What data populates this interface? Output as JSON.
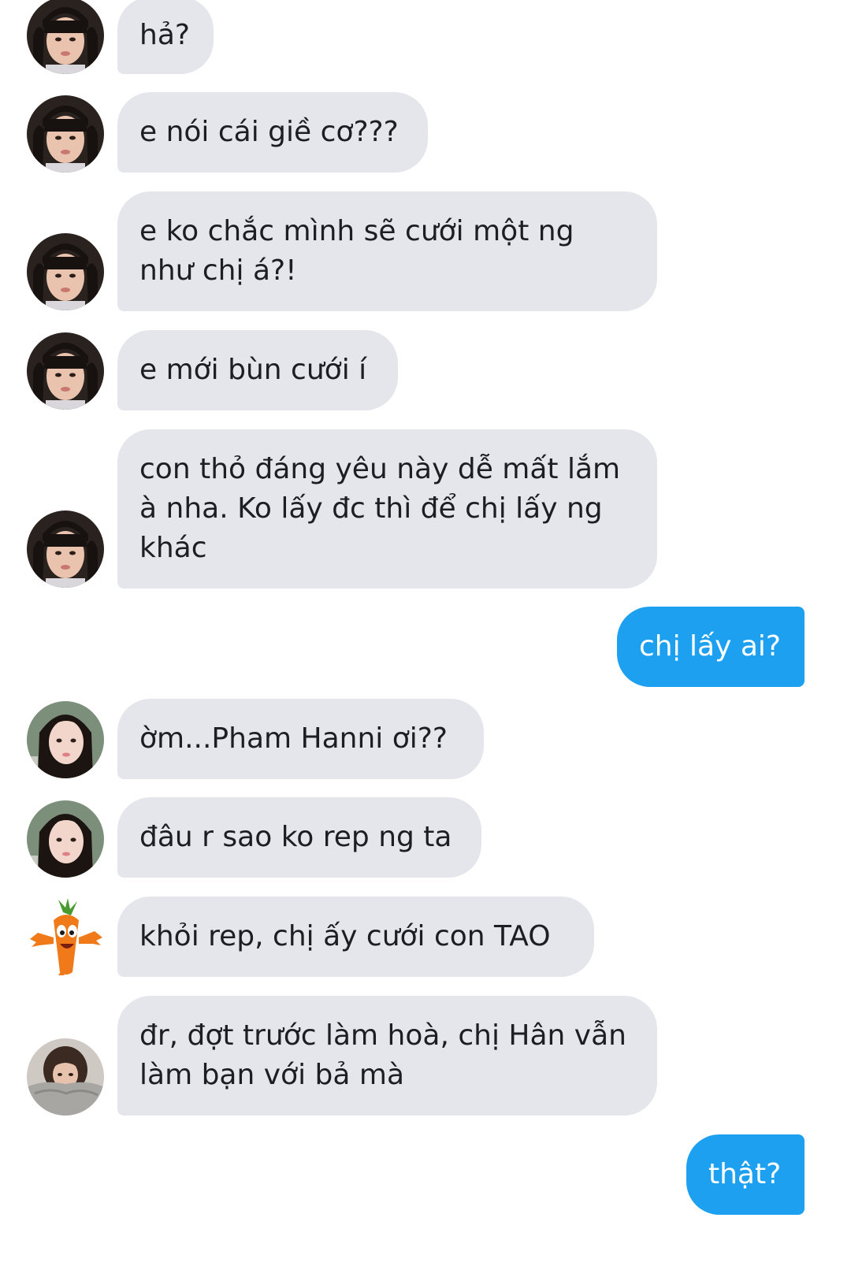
{
  "conversation": {
    "messages": [
      {
        "sender": "avatar-girl-bangs",
        "direction": "incoming",
        "text": "hả?"
      },
      {
        "sender": "avatar-girl-bangs",
        "direction": "incoming",
        "text": "e nói cái giề cơ???"
      },
      {
        "sender": "avatar-girl-bangs",
        "direction": "incoming",
        "text": "e ko chắc mình sẽ cưới một ng như chị á?!"
      },
      {
        "sender": "avatar-girl-bangs",
        "direction": "incoming",
        "text": "e mới bùn cưới í"
      },
      {
        "sender": "avatar-girl-bangs",
        "direction": "incoming",
        "text": "con thỏ đáng yêu này dễ mất lắm à nha. Ko lấy đc thì để chị lấy ng khác"
      },
      {
        "sender": "me",
        "direction": "outgoing",
        "text": "chị lấy ai?"
      },
      {
        "sender": "avatar-girl-long-hair",
        "direction": "incoming",
        "text": "ờm...Pham Hanni ơi??"
      },
      {
        "sender": "avatar-girl-long-hair",
        "direction": "incoming",
        "text": "đâu r sao ko rep ng ta"
      },
      {
        "sender": "avatar-carrot",
        "direction": "incoming",
        "text": "khỏi rep, chị ấy cưới con TAO"
      },
      {
        "sender": "avatar-girl-blanket",
        "direction": "incoming",
        "text": "đr, đợt trước làm hoà, chị Hân vẫn làm bạn với bả mà"
      },
      {
        "sender": "me",
        "direction": "outgoing",
        "text": "thật?"
      }
    ]
  },
  "colors": {
    "incoming_bubble": "#e4e6eb",
    "incoming_text": "#1c1e21",
    "outgoing_bubble": "#1ea0f1",
    "outgoing_text": "#ffffff",
    "background": "#ffffff"
  }
}
